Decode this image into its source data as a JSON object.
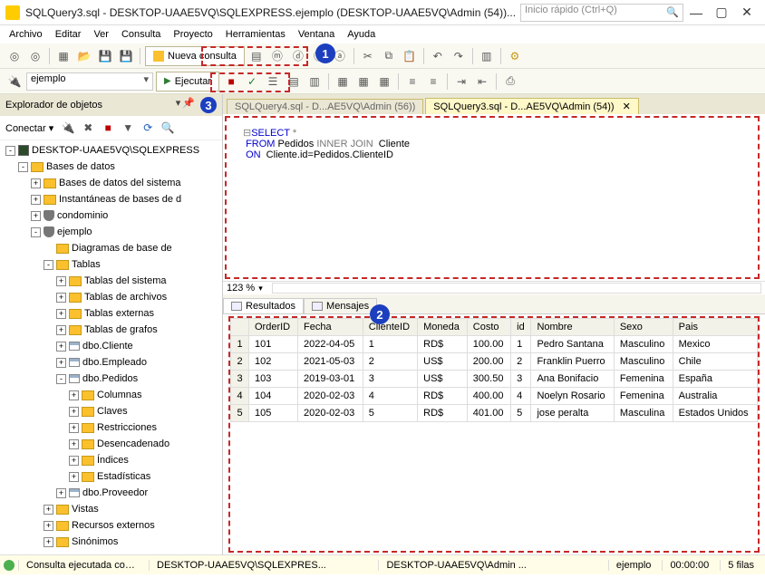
{
  "titlebar": {
    "title": "SQLQuery3.sql - DESKTOP-UAAE5VQ\\SQLEXPRESS.ejemplo (DESKTOP-UAAE5VQ\\Admin (54))...",
    "quick_placeholder": "Inicio rápido (Ctrl+Q)"
  },
  "menu": [
    "Archivo",
    "Editar",
    "Ver",
    "Consulta",
    "Proyecto",
    "Herramientas",
    "Ventana",
    "Ayuda"
  ],
  "toolbar": {
    "new_query": "Nueva consulta",
    "db_selected": "ejemplo",
    "execute": "Ejecutar"
  },
  "sidebar": {
    "header": "Explorador de objetos",
    "connect_label": "Conectar ▾",
    "tree": [
      {
        "ind": 6,
        "tgl": "-",
        "icon": "svr",
        "label": "DESKTOP-UAAE5VQ\\SQLEXPRESS"
      },
      {
        "ind": 20,
        "tgl": "-",
        "icon": "fld",
        "label": "Bases de datos"
      },
      {
        "ind": 34,
        "tgl": "+",
        "icon": "fld",
        "label": "Bases de datos del sistema"
      },
      {
        "ind": 34,
        "tgl": "+",
        "icon": "fld",
        "label": "Instantáneas de bases de d"
      },
      {
        "ind": 34,
        "tgl": "+",
        "icon": "db",
        "label": "condominio"
      },
      {
        "ind": 34,
        "tgl": "-",
        "icon": "db",
        "label": "ejemplo"
      },
      {
        "ind": 48,
        "tgl": " ",
        "icon": "fld",
        "label": "Diagramas de base de"
      },
      {
        "ind": 48,
        "tgl": "-",
        "icon": "fld",
        "label": "Tablas"
      },
      {
        "ind": 62,
        "tgl": "+",
        "icon": "fld",
        "label": "Tablas del sistema"
      },
      {
        "ind": 62,
        "tgl": "+",
        "icon": "fld",
        "label": "Tablas de archivos"
      },
      {
        "ind": 62,
        "tgl": "+",
        "icon": "fld",
        "label": "Tablas externas"
      },
      {
        "ind": 62,
        "tgl": "+",
        "icon": "fld",
        "label": "Tablas de grafos"
      },
      {
        "ind": 62,
        "tgl": "+",
        "icon": "tbl",
        "label": "dbo.Cliente"
      },
      {
        "ind": 62,
        "tgl": "+",
        "icon": "tbl",
        "label": "dbo.Empleado"
      },
      {
        "ind": 62,
        "tgl": "-",
        "icon": "tbl",
        "label": "dbo.Pedidos"
      },
      {
        "ind": 76,
        "tgl": "+",
        "icon": "fld",
        "label": "Columnas"
      },
      {
        "ind": 76,
        "tgl": "+",
        "icon": "fld",
        "label": "Claves"
      },
      {
        "ind": 76,
        "tgl": "+",
        "icon": "fld",
        "label": "Restricciones"
      },
      {
        "ind": 76,
        "tgl": "+",
        "icon": "fld",
        "label": "Desencadenado"
      },
      {
        "ind": 76,
        "tgl": "+",
        "icon": "fld",
        "label": "Índices"
      },
      {
        "ind": 76,
        "tgl": "+",
        "icon": "fld",
        "label": "Estadísticas"
      },
      {
        "ind": 62,
        "tgl": "+",
        "icon": "tbl",
        "label": "dbo.Proveedor"
      },
      {
        "ind": 48,
        "tgl": "+",
        "icon": "fld",
        "label": "Vistas"
      },
      {
        "ind": 48,
        "tgl": "+",
        "icon": "fld",
        "label": "Recursos externos"
      },
      {
        "ind": 48,
        "tgl": "+",
        "icon": "fld",
        "label": "Sinónimos"
      }
    ]
  },
  "tabs": {
    "inactive": "SQLQuery4.sql - D...AE5VQ\\Admin (56))",
    "active": "SQLQuery3.sql - D...AE5VQ\\Admin (54))"
  },
  "sql": {
    "l1a": "SELECT",
    "l1b": " *",
    "l2a": "FROM",
    "l2b": " Pedidos ",
    "l2c": "INNER JOIN",
    "l2d": "  Cliente",
    "l3a": "ON",
    "l3b": "  Cliente.id=Pedidos.ClienteID"
  },
  "zoom": "123 %",
  "results": {
    "tab_results": "Resultados",
    "tab_messages": "Mensajes",
    "columns": [
      "OrderID",
      "Fecha",
      "ClienteID",
      "Moneda",
      "Costo",
      "id",
      "Nombre",
      "Sexo",
      "Pais"
    ],
    "rows": [
      [
        "101",
        "2022-04-05",
        "1",
        "RD$",
        "100.00",
        "1",
        "Pedro Santana",
        "Masculino",
        "Mexico"
      ],
      [
        "102",
        "2021-05-03",
        "2",
        "US$",
        "200.00",
        "2",
        "Franklin Puerro",
        "Masculino",
        "Chile"
      ],
      [
        "103",
        "2019-03-01",
        "3",
        "US$",
        "300.50",
        "3",
        "Ana Bonifacio",
        "Femenina",
        "España"
      ],
      [
        "104",
        "2020-02-03",
        "4",
        "RD$",
        "400.00",
        "4",
        "Noelyn Rosario",
        "Femenina",
        "Australia"
      ],
      [
        "105",
        "2020-02-03",
        "5",
        "RD$",
        "401.00",
        "5",
        "jose peralta",
        "Masculina",
        "Estados Unidos"
      ]
    ]
  },
  "status": {
    "ok": "Consulta ejecutada correctamente.",
    "server": "DESKTOP-UAAE5VQ\\SQLEXPRES...",
    "user": "DESKTOP-UAAE5VQ\\Admin ...",
    "db": "ejemplo",
    "time": "00:00:00",
    "rows": "5 filas"
  },
  "markers": {
    "m1": "1",
    "m2": "2",
    "m3": "3"
  }
}
